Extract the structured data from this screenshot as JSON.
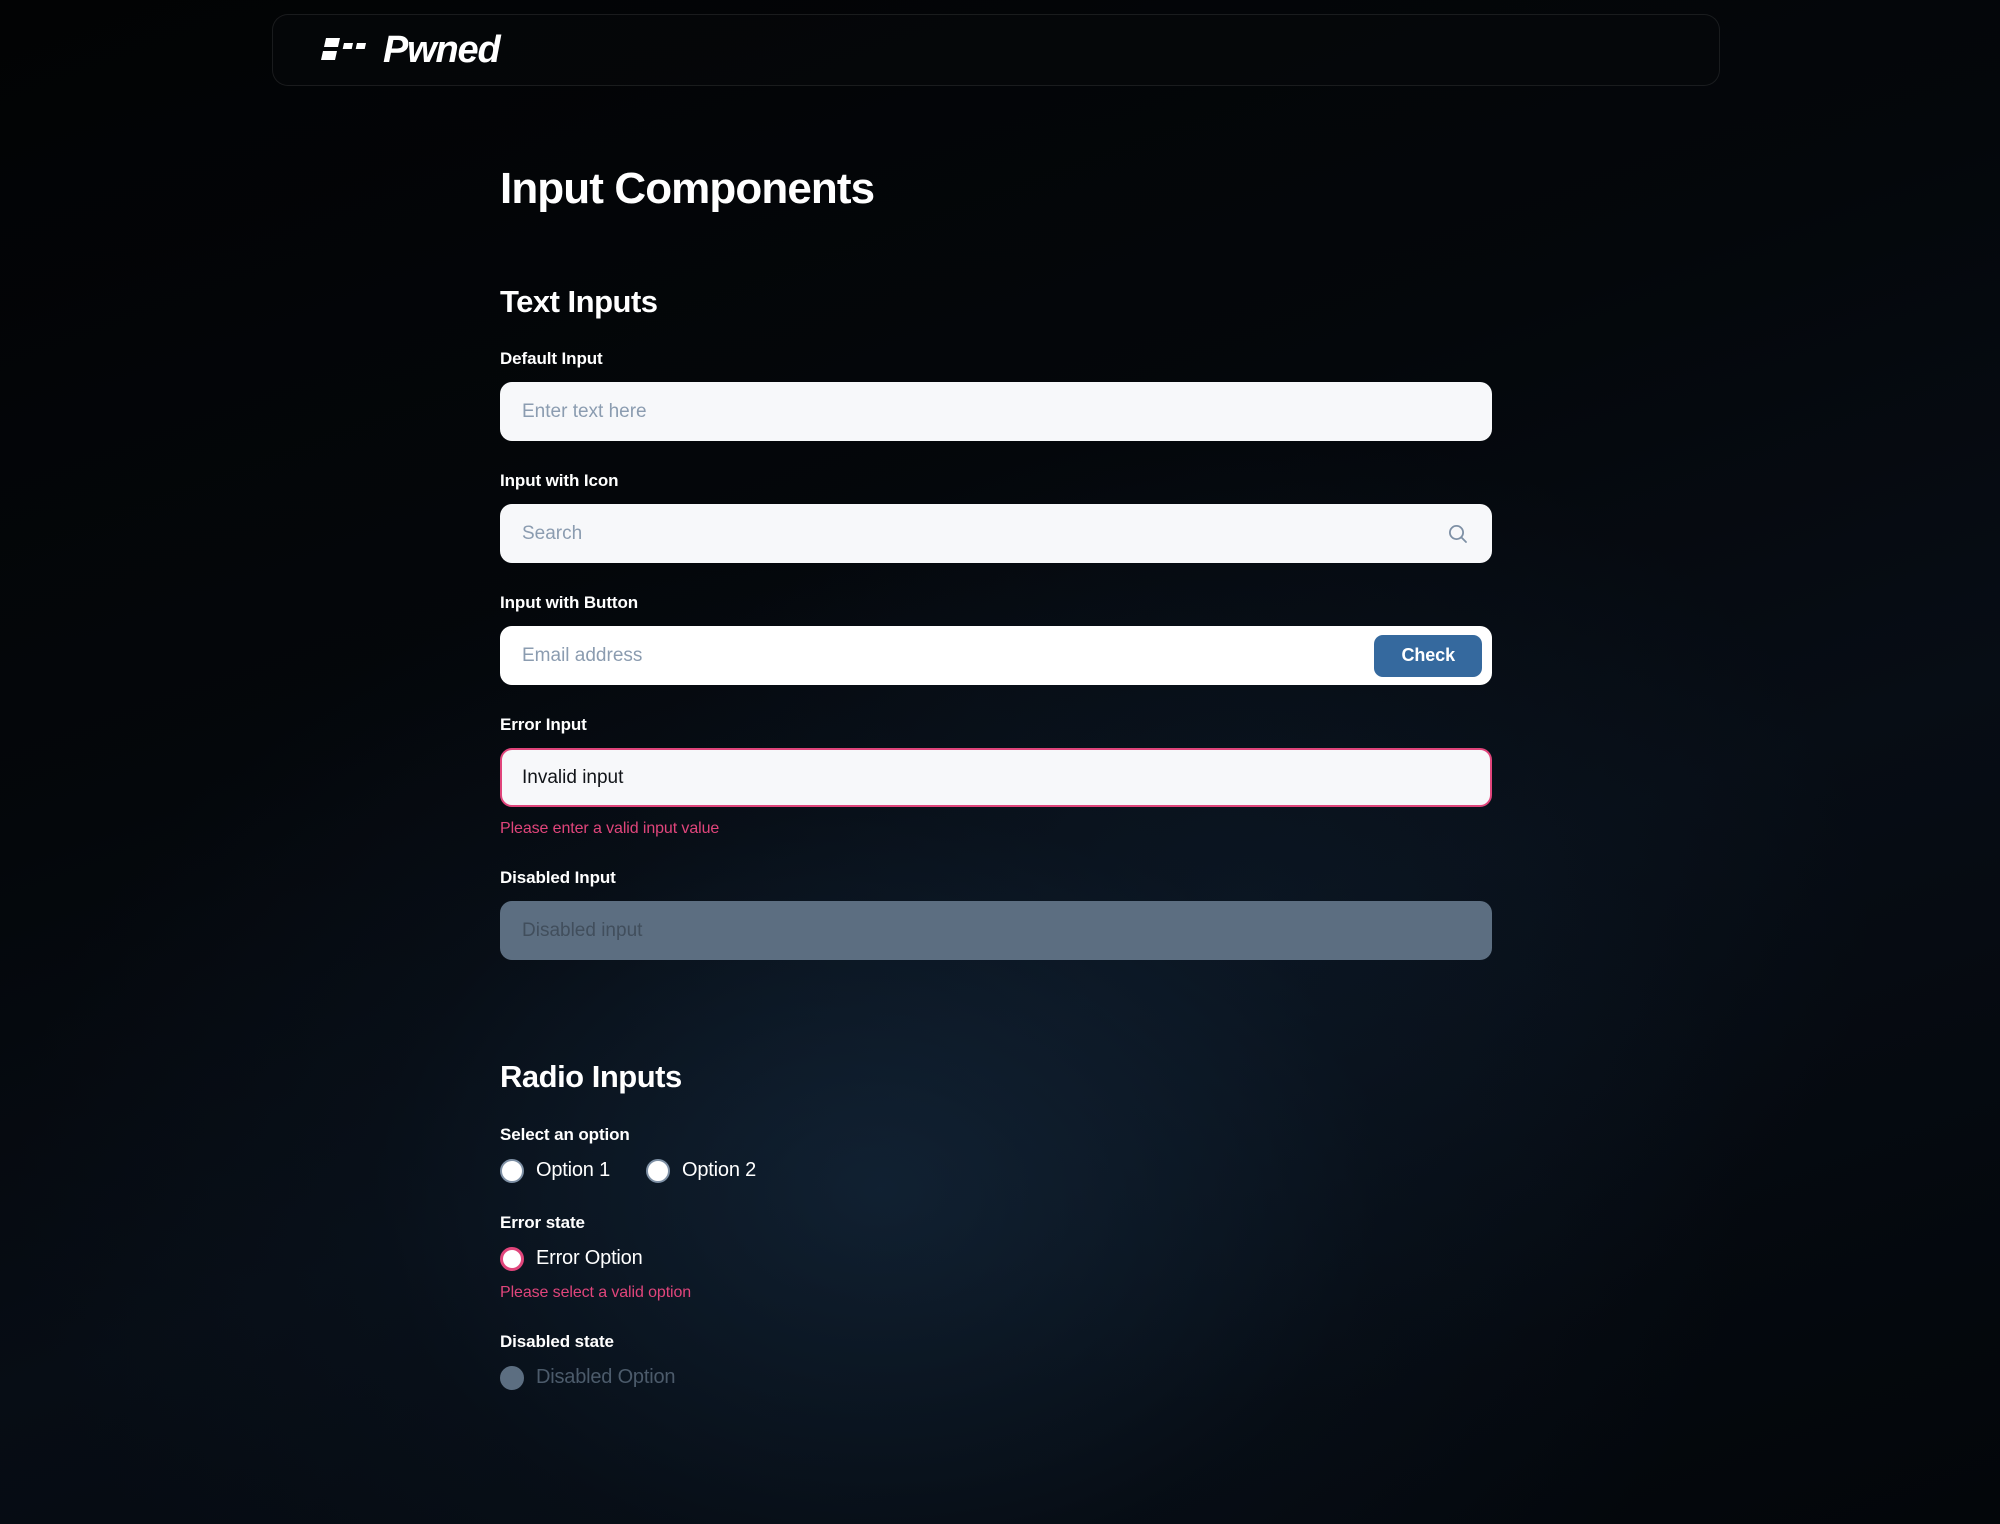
{
  "header": {
    "logo_text": "Pwned",
    "logo_mark_name": "pwned-bars-logo-mark"
  },
  "page_title": "Input Components",
  "sections": {
    "text_inputs": {
      "title": "Text Inputs",
      "fields": {
        "default": {
          "label": "Default Input",
          "placeholder": "Enter text here",
          "value": ""
        },
        "with_icon": {
          "label": "Input with Icon",
          "placeholder": "Search",
          "value": "",
          "icon": "search-icon"
        },
        "with_button": {
          "label": "Input with Button",
          "placeholder": "Email address",
          "value": "",
          "button_label": "Check"
        },
        "error": {
          "label": "Error Input",
          "value": "Invalid input",
          "message": "Please enter a valid input value"
        },
        "disabled": {
          "label": "Disabled Input",
          "placeholder": "Disabled input",
          "value": ""
        }
      }
    },
    "radio_inputs": {
      "title": "Radio Inputs",
      "select_group": {
        "label": "Select an option",
        "options": [
          {
            "label": "Option 1"
          },
          {
            "label": "Option 2"
          }
        ]
      },
      "error_group": {
        "label": "Error state",
        "option_label": "Error Option",
        "message": "Please select a valid option"
      },
      "disabled_group": {
        "label": "Disabled state",
        "option_label": "Disabled Option"
      }
    }
  },
  "colors": {
    "background": "#030405",
    "input_bg": "#f7f8fa",
    "input_bg_white": "#ffffff",
    "placeholder": "#8b9cb0",
    "accent_button": "#35699e",
    "error": "#e0457b",
    "disabled_fill": "#5c6e81",
    "disabled_text": "#4c5b6b",
    "text": "#ffffff"
  }
}
